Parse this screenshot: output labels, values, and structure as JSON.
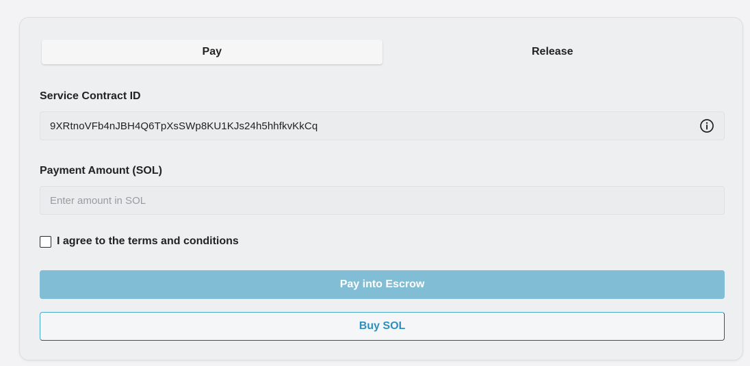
{
  "tabs": [
    {
      "label": "Pay",
      "active": true
    },
    {
      "label": "Release",
      "active": false
    }
  ],
  "contract": {
    "label": "Service Contract ID",
    "value": "9XRtnoVFb4nJBH4Q6TpXsSWp8KU1KJs24h5hhfkvKkCq",
    "icon": "info-icon"
  },
  "amount": {
    "label": "Payment Amount (SOL)",
    "value": "",
    "placeholder": "Enter amount in SOL"
  },
  "terms": {
    "label": "I agree to the terms and conditions",
    "checked": false
  },
  "buttons": {
    "pay_label": "Pay into Escrow",
    "buy_label": "Buy SOL"
  },
  "colors": {
    "primary_button": "#82bdd6",
    "outline_accent": "#2b8fbf"
  }
}
